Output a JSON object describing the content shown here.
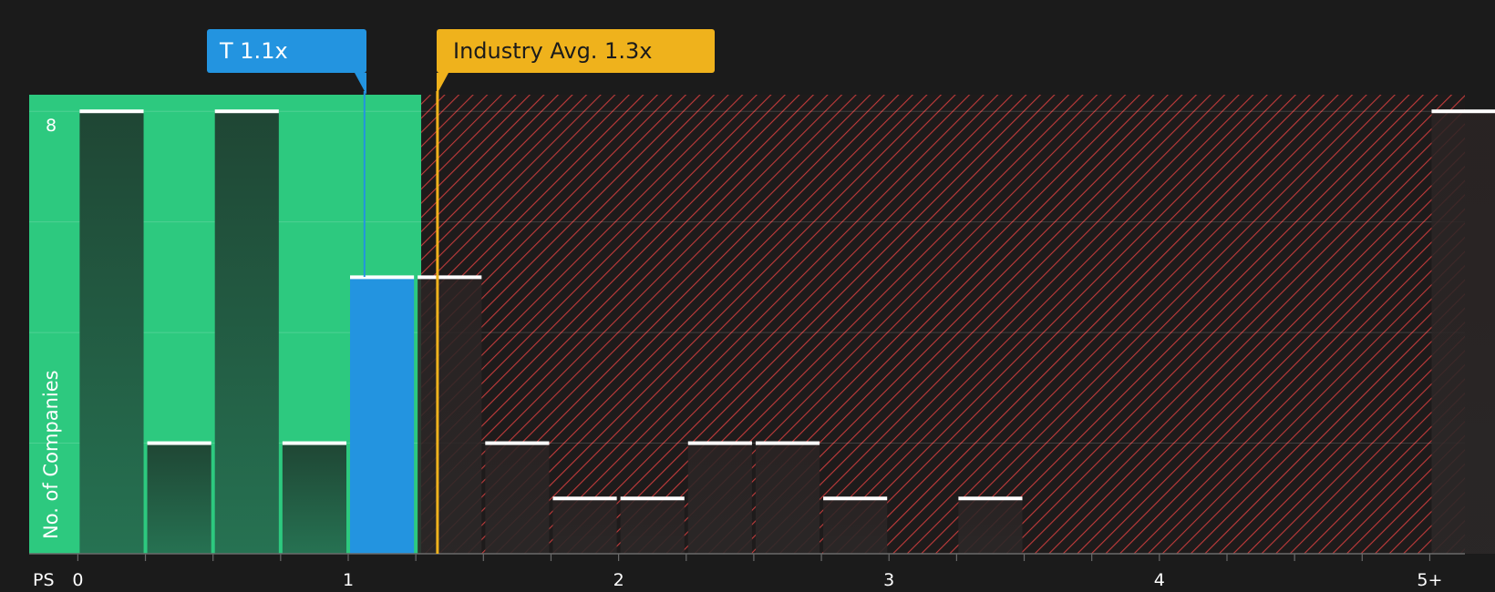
{
  "colors": {
    "background": "#1b1b1b",
    "undervalued": "#2dc97f",
    "overvalued_hatch": "#c23b3b",
    "company": "#2394e0",
    "industry": "#efb21c",
    "bar_dark": "#1f4a37",
    "bar_overvalued": "#2a2424"
  },
  "callouts": {
    "company_label": "T 1.1x",
    "industry_label": "Industry Avg. 1.3x"
  },
  "chart_data": {
    "type": "bar",
    "xlabel": "PS",
    "ylabel": "No. of Companies",
    "bin_width": 0.25,
    "xlim": [
      -0.18,
      5.13
    ],
    "ylim": [
      0,
      8.3
    ],
    "x_ticks": [
      {
        "value": 0,
        "label": "0"
      },
      {
        "value": 1,
        "label": "1"
      },
      {
        "value": 2,
        "label": "2"
      },
      {
        "value": 3,
        "label": "3"
      },
      {
        "value": 4,
        "label": "4"
      },
      {
        "value": 5,
        "label": "5+"
      }
    ],
    "y_ticks": [
      {
        "value": 8,
        "label": "8"
      }
    ],
    "y_gridlines": [
      2,
      4,
      6,
      8
    ],
    "company_value": 1.06,
    "industry_value": 1.33,
    "fair_value_boundary": 1.27,
    "bins": [
      {
        "start": 0.0,
        "count": 8
      },
      {
        "start": 0.25,
        "count": 2
      },
      {
        "start": 0.5,
        "count": 8
      },
      {
        "start": 0.75,
        "count": 2
      },
      {
        "start": 1.0,
        "count": 5,
        "highlight": true
      },
      {
        "start": 1.25,
        "count": 5
      },
      {
        "start": 1.5,
        "count": 2
      },
      {
        "start": 1.75,
        "count": 1
      },
      {
        "start": 2.0,
        "count": 1
      },
      {
        "start": 2.25,
        "count": 2
      },
      {
        "start": 2.5,
        "count": 2
      },
      {
        "start": 2.75,
        "count": 1
      },
      {
        "start": 3.0,
        "count": 0
      },
      {
        "start": 3.25,
        "count": 1
      },
      {
        "start": 3.5,
        "count": 0
      },
      {
        "start": 3.75,
        "count": 0
      },
      {
        "start": 4.0,
        "count": 0
      },
      {
        "start": 4.25,
        "count": 0
      },
      {
        "start": 4.5,
        "count": 0
      },
      {
        "start": 4.75,
        "count": 0
      },
      {
        "start": 5.0,
        "count": 8
      }
    ]
  }
}
